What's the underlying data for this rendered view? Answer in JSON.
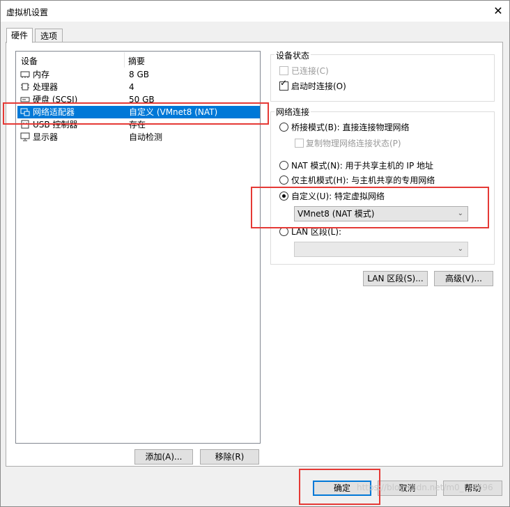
{
  "window": {
    "title": "虚拟机设置"
  },
  "tabs": [
    {
      "label": "硬件"
    },
    {
      "label": "选项"
    }
  ],
  "device_list": {
    "headers": {
      "device": "设备",
      "summary": "摘要"
    },
    "rows": [
      {
        "name": "内存",
        "summary": "8 GB",
        "icon": "memory-icon"
      },
      {
        "name": "处理器",
        "summary": "4",
        "icon": "cpu-icon"
      },
      {
        "name": "硬盘 (SCSI)",
        "summary": "50 GB",
        "icon": "harddisk-icon"
      },
      {
        "name": "网络适配器",
        "summary": "自定义 (VMnet8 (NAT)",
        "icon": "network-adapter-icon",
        "selected": true
      },
      {
        "name": "USB 控制器",
        "summary": "存在",
        "icon": "usb-icon"
      },
      {
        "name": "显示器",
        "summary": "自动检测",
        "icon": "monitor-icon"
      }
    ]
  },
  "device_status": {
    "title": "设备状态",
    "connected_label": "已连接(C)",
    "connect_at_power_on_label": "启动时连接(O)"
  },
  "network": {
    "title": "网络连接",
    "bridged_label": "桥接模式(B): 直接连接物理网络",
    "replicate_label": "复制物理网络连接状态(P)",
    "nat_label": "NAT 模式(N): 用于共享主机的 IP 地址",
    "hostonly_label": "仅主机模式(H): 与主机共享的专用网络",
    "custom_label": "自定义(U): 特定虚拟网络",
    "custom_selected": "VMnet8 (NAT 模式)",
    "lan_label": "LAN 区段(L):"
  },
  "buttons": {
    "lan_segments": "LAN 区段(S)...",
    "advanced": "高级(V)...",
    "add": "添加(A)...",
    "remove": "移除(R)",
    "ok": "确定",
    "cancel": "取消",
    "help": "帮助"
  },
  "watermark": "https://blog.csdn.net/m0_...3696",
  "colors": {
    "selection": "#0078d7",
    "highlight_box": "#e53935"
  }
}
